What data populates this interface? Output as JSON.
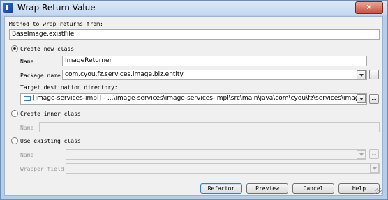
{
  "window": {
    "title": "Wrap Return Value",
    "close_glyph": "✕"
  },
  "method_label": "Method to wrap returns from:",
  "method_value": "BaseImage.existFile",
  "create_new_class": {
    "label": "Create new class",
    "selected": true,
    "name_label": "Name",
    "name_value": "ImageReturner",
    "package_label": "Package name",
    "package_value": "com.cyou.fz.services.image.biz.entity",
    "target_label": "Target destination directory:",
    "target_value": "[image-services-impl] - ...\\image-services\\image-services-impl\\src\\main\\java\\com\\cyou\\fz\\services\\image\\biz\\entity"
  },
  "create_inner_class": {
    "label": "Create inner class",
    "selected": false,
    "name_label": "Name",
    "name_value": ""
  },
  "use_existing_class": {
    "label": "Use existing class",
    "selected": false,
    "name_label": "Name",
    "name_value": "",
    "wrapper_label": "Wrapper field",
    "wrapper_value": ""
  },
  "ellipsis": "...",
  "buttons": {
    "refactor": "Refactor",
    "preview": "Preview",
    "cancel": "Cancel",
    "help": "Help"
  }
}
